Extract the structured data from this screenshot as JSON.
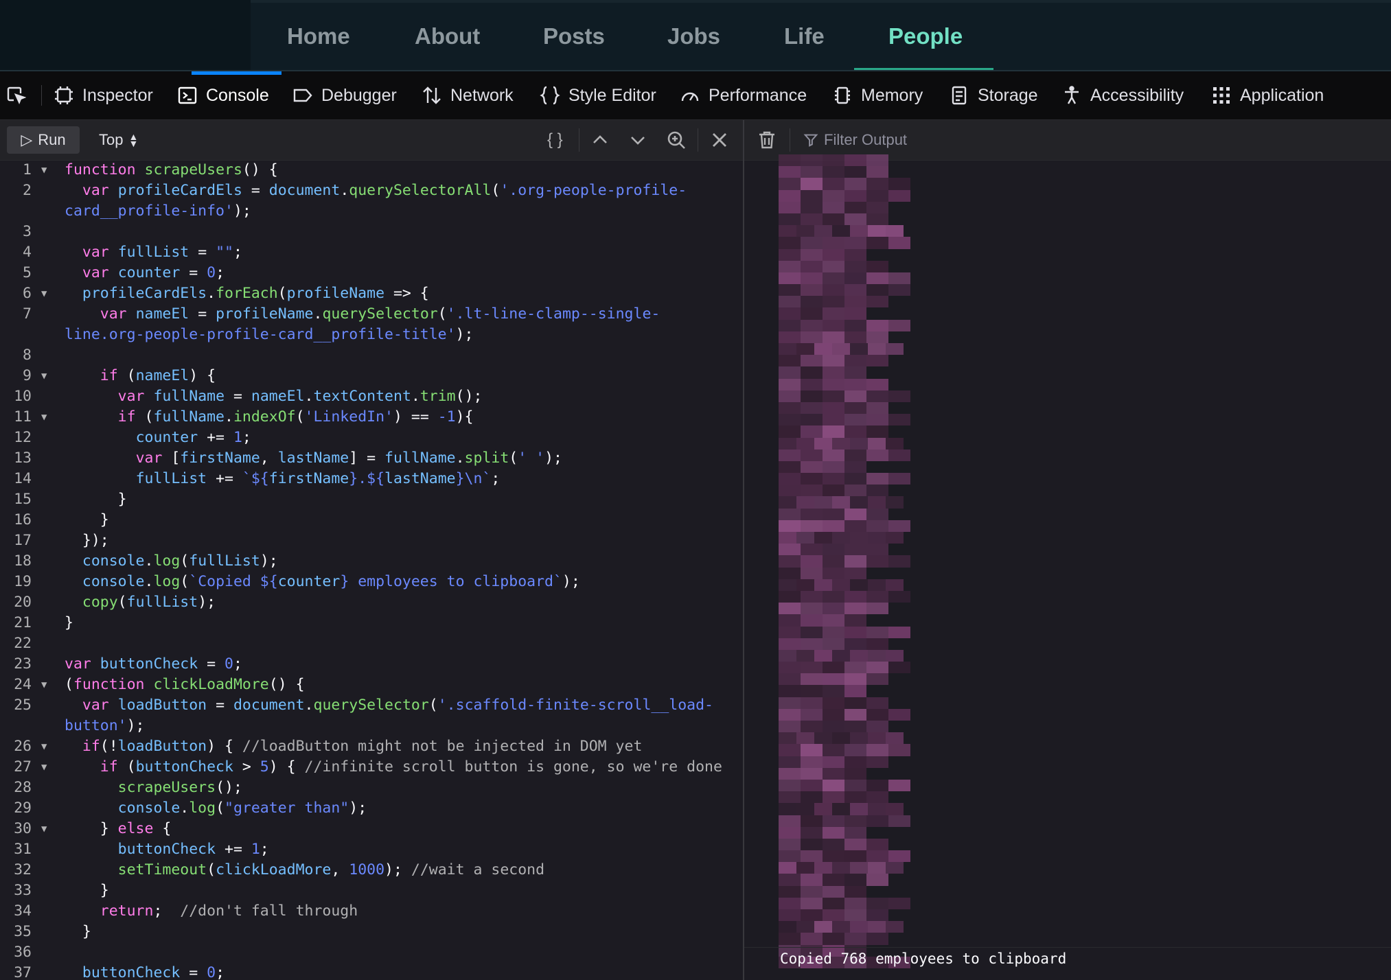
{
  "site_nav": {
    "links": [
      {
        "label": "Home",
        "active": false
      },
      {
        "label": "About",
        "active": false
      },
      {
        "label": "Posts",
        "active": false
      },
      {
        "label": "Jobs",
        "active": false
      },
      {
        "label": "Life",
        "active": false
      },
      {
        "label": "People",
        "active": true
      }
    ],
    "accent_color": "#72e0c4"
  },
  "devtools": {
    "tabs": [
      {
        "label": "Inspector",
        "icon": "inspector-icon"
      },
      {
        "label": "Console",
        "icon": "console-icon",
        "active": true
      },
      {
        "label": "Debugger",
        "icon": "debugger-icon"
      },
      {
        "label": "Network",
        "icon": "network-icon"
      },
      {
        "label": "Style Editor",
        "icon": "style-editor-icon"
      },
      {
        "label": "Performance",
        "icon": "performance-icon"
      },
      {
        "label": "Memory",
        "icon": "memory-icon"
      },
      {
        "label": "Storage",
        "icon": "storage-icon"
      },
      {
        "label": "Accessibility",
        "icon": "accessibility-icon"
      },
      {
        "label": "Application",
        "icon": "application-icon"
      }
    ],
    "editor": {
      "run_label": "Run",
      "context_label": "Top",
      "pretty_print_label": "{ }"
    },
    "output": {
      "filter_placeholder": "Filter Output",
      "last_message": "Copied 768 employees to clipboard"
    }
  }
}
